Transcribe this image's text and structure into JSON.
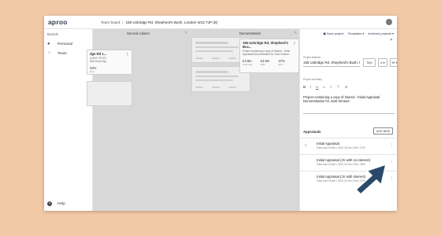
{
  "app": {
    "logo": "aproo"
  },
  "breadcrumb": {
    "parent": "Team board",
    "current": "156 Uxbridge Rd, Shepherd's Bush, London W12 7JP (E)"
  },
  "sidebar": {
    "heading": "Boards",
    "items": [
      {
        "label": "Personal"
      },
      {
        "label": "Team"
      }
    ],
    "help": "Help"
  },
  "board": {
    "columns": [
      {
        "title": ""
      },
      {
        "title": "Second column"
      },
      {
        "title": "Demonstration"
      }
    ],
    "partial_card": {
      "title": "dge Rd 1...",
      "desc": "g W12 7JP (E)",
      "desc2": "sent Demo lag",
      "value": "32%",
      "value_label": "RoC"
    },
    "demo_card": {
      "title": "156 Uxbridge Rd, Shepherd's Bus...",
      "desc": "Project containing a copy of shared - Initial Appraisal Demonstration for Joint Venture",
      "metrics": [
        {
          "value": "£4.8m",
          "label": "Total cost"
        },
        {
          "value": "£4.9m",
          "label": "GDV"
        },
        {
          "value": "37%",
          "label": "RoC"
        }
      ]
    }
  },
  "panel": {
    "tools": {
      "save": "Save project",
      "templates": "Templates",
      "archived": "Archived projects"
    },
    "address_label": "Project address",
    "address_value": "156 Uxbridge Rd, Shepherd's Bush, London W12 7JP",
    "tax_label": "TAX",
    "currency": "£",
    "unit": "ft²",
    "summary_label": "Project summary",
    "summary_text": "Project containing a copy of shared - Initial Appraisal Demonstration for Joint Venture",
    "appraisals_title": "Appraisals",
    "add_new": "ADD NEW",
    "appraisals": [
      {
        "name": "Initial Appraisal",
        "meta": "Total cost: £4.8m • GDV: £4.9m • RoC: 37%"
      },
      {
        "name": "Initial Appraisal (JV with no interest)",
        "meta": "Total cost: £4.8m • GDV: £4.9m • RoC: 38%"
      },
      {
        "name": "Initial Appraisal (JV with interest)",
        "meta": "Total cost: £4.8m • GDV: £4.9m • RoC: 37%"
      }
    ]
  },
  "colors": {
    "background": "#f2c9a6",
    "arrow": "#2b4a6b",
    "board": "#d8d8d8"
  },
  "icons": [
    "user-icon",
    "person-icon",
    "team-icon",
    "help-icon",
    "pencil-icon",
    "kebab-icon",
    "star-icon",
    "close-icon",
    "arrow-pointer-icon"
  ]
}
